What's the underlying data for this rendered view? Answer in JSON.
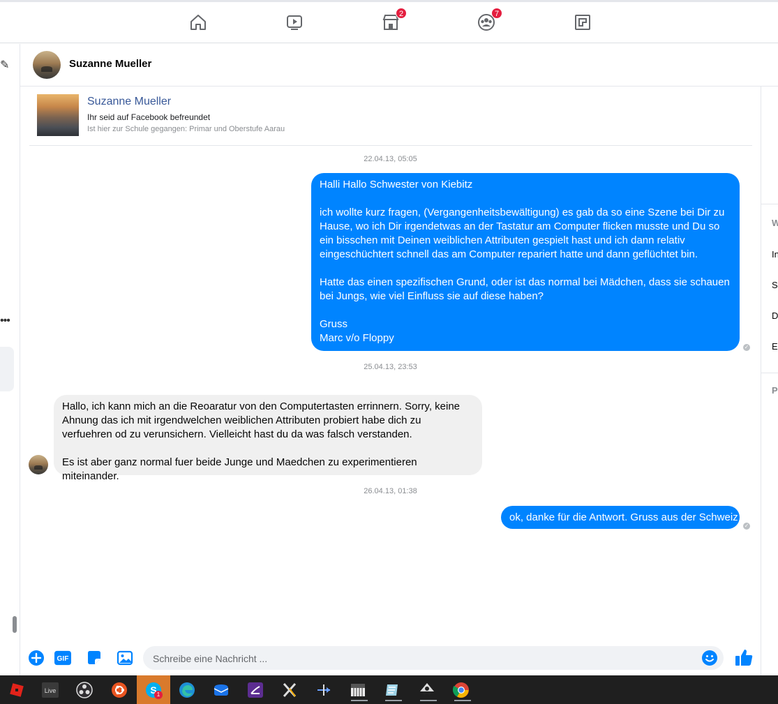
{
  "topnav": {
    "items": [
      {
        "name": "home",
        "badge": ""
      },
      {
        "name": "watch",
        "badge": ""
      },
      {
        "name": "marketplace",
        "badge": "2"
      },
      {
        "name": "groups",
        "badge": "7"
      },
      {
        "name": "gaming",
        "badge": ""
      }
    ]
  },
  "chat": {
    "contact_name": "Suzanne Mueller",
    "profile_card": {
      "name": "Suzanne Mueller",
      "friend_status": "Ihr seid auf Facebook befreundet",
      "school": "Ist hier zur Schule gegangen: Primar und Oberstufe Aarau"
    },
    "timestamps": [
      "22.04.13, 05:05",
      "25.04.13, 23:53",
      "26.04.13, 01:38"
    ],
    "messages": [
      {
        "direction": "out",
        "paragraphs": [
          "Halli Hallo Schwester von Kiebitz",
          "ich wollte kurz fragen, (Vergangenheitsbewältigung) es gab da so eine Szene bei Dir zu Hause, wo ich Dir irgendetwas an der Tastatur am Computer flicken musste und Du so ein bisschen mit Deinen weiblichen Attributen gespielt hast und ich dann relativ eingeschüchtert schnell das am Computer repariert hatte und dann geflüchtet bin.",
          "Hatte das einen spezifischen Grund, oder ist das normal bei Mädchen, dass sie schauen bei Jungs, wie viel Einfluss sie auf diese haben?",
          "Gruss\nMarc v/o Floppy"
        ]
      },
      {
        "direction": "in",
        "paragraphs": [
          "Hallo, ich kann mich an die Reoaratur von den Computertasten errinnern. Sorry, keine Ahnung das ich mit irgendwelchen weiblichen Attributen probiert habe dich zu verfuehren od zu verunsichern. Vielleicht hast du da was falsch verstanden.",
          "Es ist aber ganz normal fuer beide Junge und Maedchen zu experimentieren miteinander."
        ]
      },
      {
        "direction": "out",
        "paragraphs": [
          "ok, danke für die Antwort. Gruss aus der Schweiz"
        ]
      }
    ]
  },
  "right_panel": {
    "items": [
      "W",
      "In",
      "Sp",
      "D",
      "Er",
      "Pl"
    ]
  },
  "composer": {
    "placeholder": "Schreibe eine Nachricht ...",
    "gif_label": "GIF"
  },
  "taskbar": {
    "apps": [
      "roblox",
      "live",
      "obs",
      "ubuntu",
      "skype",
      "edge",
      "outlook",
      "visual-studio",
      "x-app",
      "azure",
      "piano",
      "notes",
      "inkscape",
      "chrome"
    ],
    "skype_badge": "1",
    "live_label": "Live"
  },
  "colors": {
    "messenger_blue": "#0084ff",
    "incoming_gray": "#f0f0f0",
    "badge_red": "#e41e3f",
    "link_blue": "#385898"
  }
}
